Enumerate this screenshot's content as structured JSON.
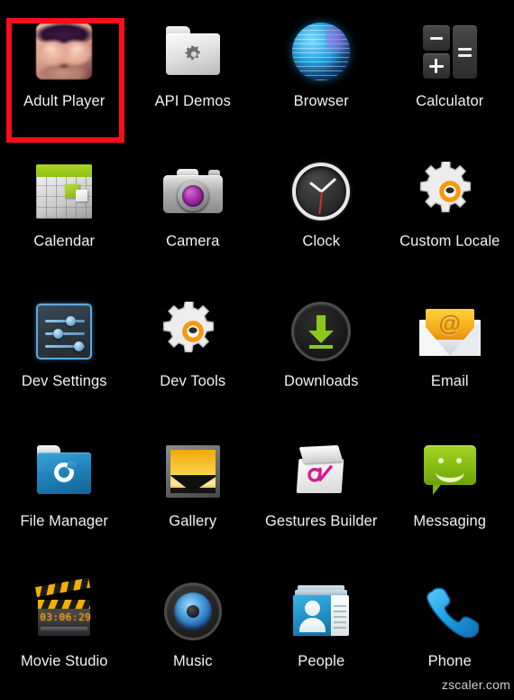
{
  "screen": {
    "background_color": "#000000",
    "text_color": "#f2f2f2",
    "highlight_color": "#fb0d1b",
    "columns": 4
  },
  "watermark": {
    "text": "zscaler.com"
  },
  "apps": [
    {
      "label": "Adult Player",
      "icon": "adult-player-icon",
      "highlighted": true
    },
    {
      "label": "API Demos",
      "icon": "folder-gear-icon",
      "highlighted": false
    },
    {
      "label": "Browser",
      "icon": "globe-icon",
      "highlighted": false
    },
    {
      "label": "Calculator",
      "icon": "calculator-icon",
      "highlighted": false
    },
    {
      "label": "Calendar",
      "icon": "calendar-icon",
      "highlighted": false
    },
    {
      "label": "Camera",
      "icon": "camera-icon",
      "highlighted": false
    },
    {
      "label": "Clock",
      "icon": "clock-icon",
      "highlighted": false
    },
    {
      "label": "Custom Locale",
      "icon": "gear-icon",
      "highlighted": false
    },
    {
      "label": "Dev Settings",
      "icon": "sliders-icon",
      "highlighted": false
    },
    {
      "label": "Dev Tools",
      "icon": "gear-icon",
      "highlighted": false
    },
    {
      "label": "Downloads",
      "icon": "download-arrow-icon",
      "highlighted": false
    },
    {
      "label": "Email",
      "icon": "envelope-at-icon",
      "highlighted": false
    },
    {
      "label": "File Manager",
      "icon": "blue-folder-icon",
      "highlighted": false
    },
    {
      "label": "Gallery",
      "icon": "photo-frame-icon",
      "highlighted": false
    },
    {
      "label": "Gestures Builder",
      "icon": "gesture-pad-icon",
      "highlighted": false
    },
    {
      "label": "Messaging",
      "icon": "speech-bubble-icon",
      "highlighted": false
    },
    {
      "label": "Movie Studio",
      "icon": "clapperboard-icon",
      "highlighted": false
    },
    {
      "label": "Music",
      "icon": "speaker-icon",
      "highlighted": false
    },
    {
      "label": "People",
      "icon": "contact-card-icon",
      "highlighted": false
    },
    {
      "label": "Phone",
      "icon": "handset-icon",
      "highlighted": false
    }
  ],
  "icon_details": {
    "movie_studio_timecode": "03:06:29",
    "email_symbol": "@",
    "calculator_keys": [
      "minus",
      "plus",
      "equals"
    ]
  }
}
